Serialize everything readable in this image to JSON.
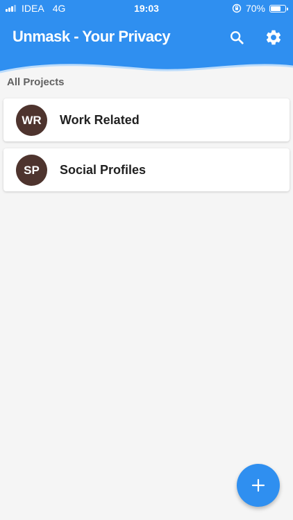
{
  "status_bar": {
    "carrier": "IDEA",
    "network": "4G",
    "time": "19:03",
    "battery_percent": "70%",
    "battery_level": 0.7
  },
  "app_bar": {
    "title": "Unmask - Your Privacy",
    "color": "#2f8ff0",
    "actions": [
      {
        "icon": "search-icon"
      },
      {
        "icon": "gear-icon"
      }
    ]
  },
  "section": {
    "label": "All Projects"
  },
  "projects": [
    {
      "initials": "WR",
      "name": "Work Related",
      "avatar_color": "#4e342e"
    },
    {
      "initials": "SP",
      "name": "Social Profiles",
      "avatar_color": "#4e342e"
    }
  ],
  "fab": {
    "icon": "plus-icon"
  }
}
